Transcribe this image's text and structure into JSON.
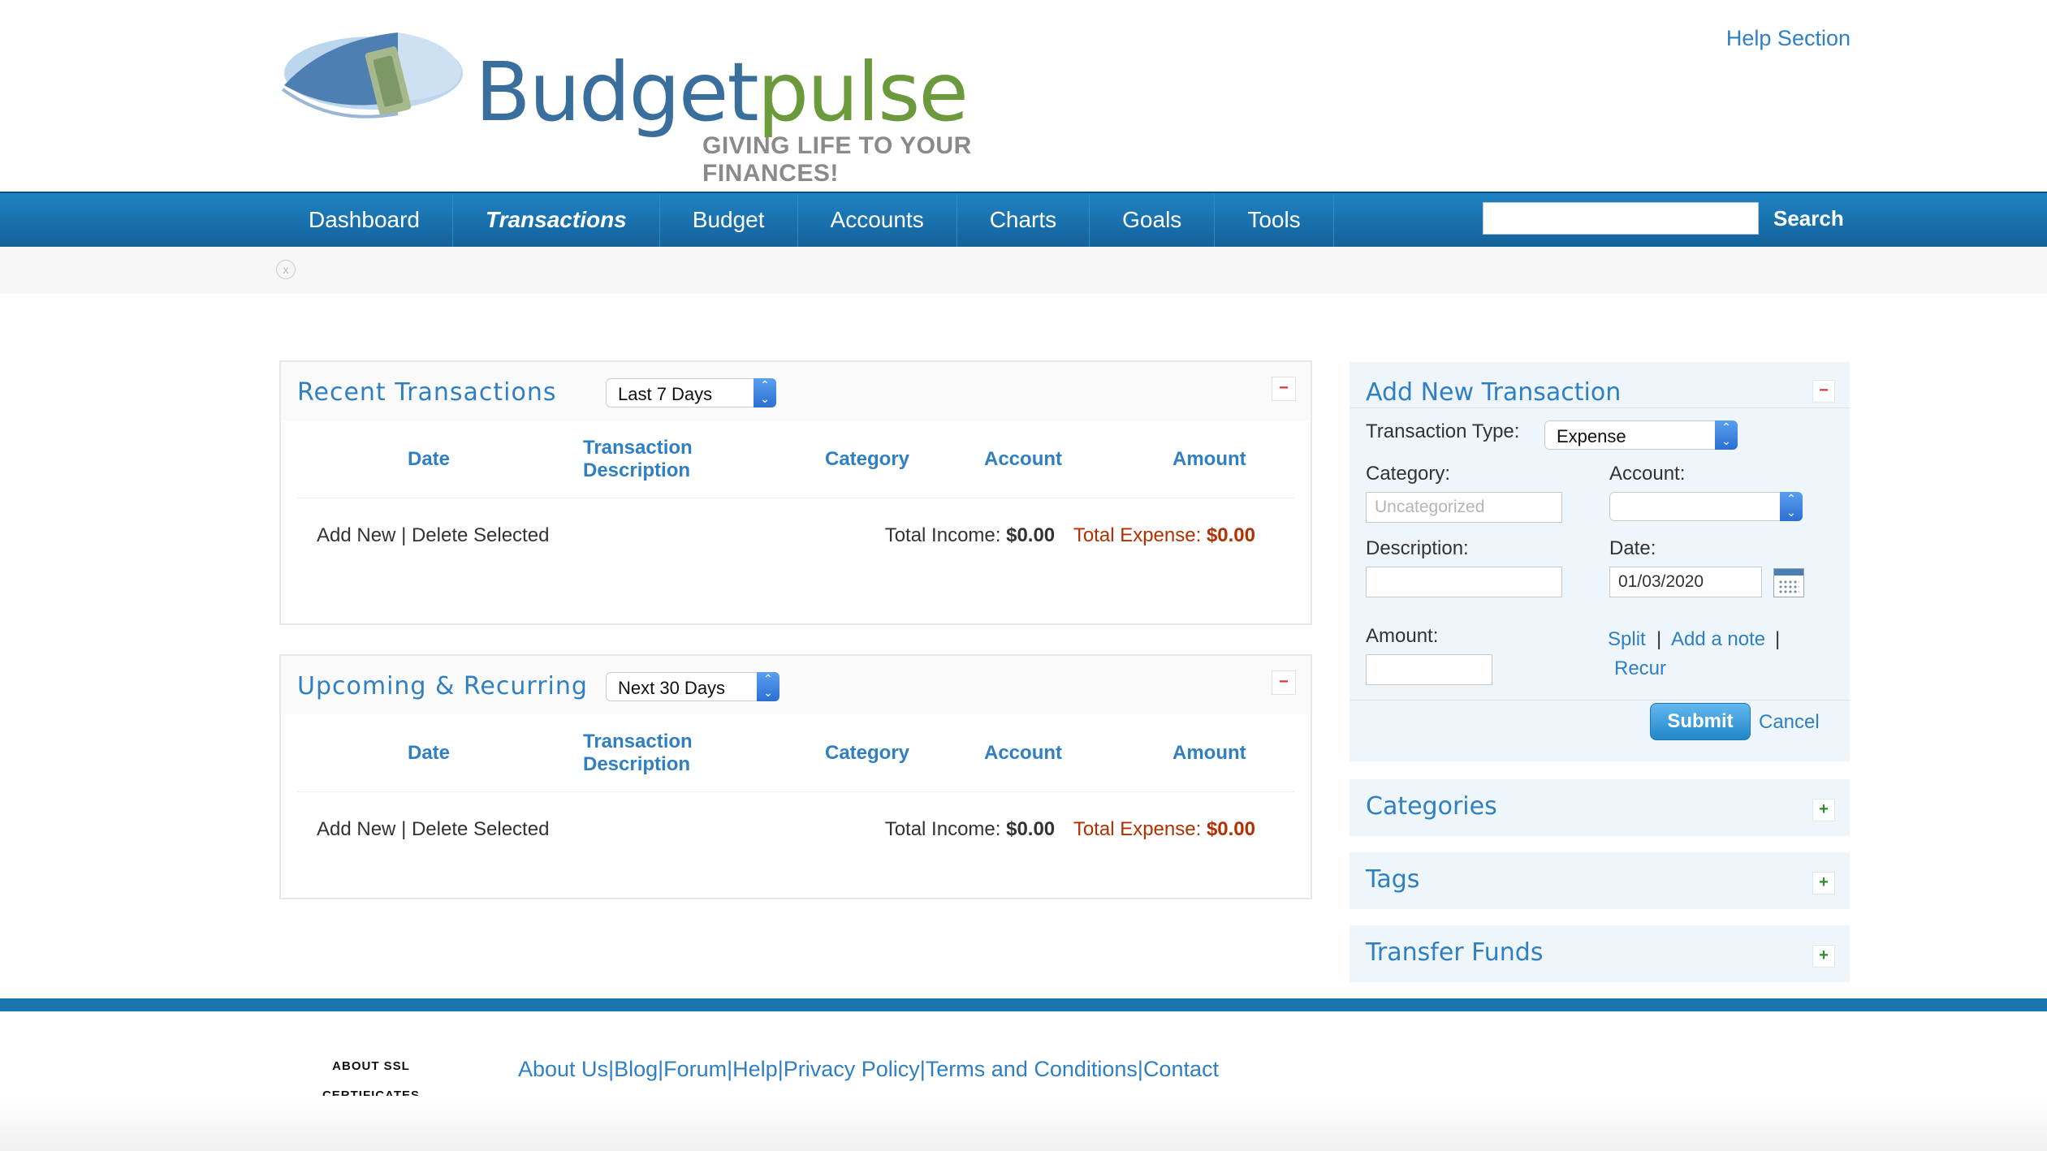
{
  "header": {
    "brand_budget": "Budget",
    "brand_pulse": "pulse",
    "tagline": "GIVING LIFE TO YOUR FINANCES!",
    "help_link": "Help Section"
  },
  "nav": {
    "items": [
      "Dashboard",
      "Transactions",
      "Budget",
      "Accounts",
      "Charts",
      "Goals",
      "Tools"
    ],
    "active": "Transactions",
    "search_button": "Search",
    "search_value": ""
  },
  "recent": {
    "title": "Recent Transactions",
    "range": "Last 7 Days",
    "columns": [
      "Date",
      "Transaction Description",
      "Category",
      "Account",
      "Amount"
    ],
    "add_new": "Add New",
    "separator": "|",
    "delete_selected": "Delete Selected",
    "income_label": "Total Income:",
    "income_value": "$0.00",
    "expense_label": "Total Expense:",
    "expense_value": "$0.00"
  },
  "upcoming": {
    "title": "Upcoming & Recurring",
    "range": "Next 30 Days",
    "columns": [
      "Date",
      "Transaction Description",
      "Category",
      "Account",
      "Amount"
    ],
    "add_new": "Add New",
    "separator": "|",
    "delete_selected": "Delete Selected",
    "income_label": "Total Income:",
    "income_value": "$0.00",
    "expense_label": "Total Expense:",
    "expense_value": "$0.00"
  },
  "add_transaction": {
    "title": "Add New Transaction",
    "type_label": "Transaction Type:",
    "type_value": "Expense",
    "category_label": "Category:",
    "category_placeholder": "Uncategorized",
    "account_label": "Account:",
    "account_value": "",
    "description_label": "Description:",
    "date_label": "Date:",
    "date_value": "01/03/2020",
    "amount_label": "Amount:",
    "split": "Split",
    "add_note": "Add a note",
    "recur": "Recur",
    "link_sep": "|",
    "submit": "Submit",
    "cancel": "Cancel"
  },
  "sidebar_boxes": [
    "Categories",
    "Tags",
    "Transfer Funds"
  ],
  "footer": {
    "ssl_line1": "ABOUT SSL",
    "ssl_line2": "CERTIFICATES",
    "links": [
      "About Us",
      "Blog",
      "Forum",
      "Help",
      "Privacy Policy",
      "Terms and Conditions",
      "Contact"
    ],
    "sep": "|"
  },
  "colors": {
    "brand_blue": "#2f7fc2",
    "nav_blue": "#1a73b0",
    "brand_green": "#6b9a3c",
    "expense_red": "#b33000"
  }
}
